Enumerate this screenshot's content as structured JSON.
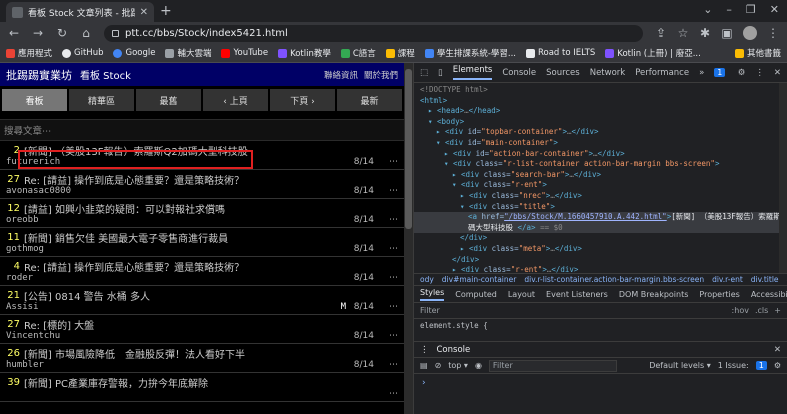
{
  "browser": {
    "tab_title": "看板 Stock 文章列表 - 批踢踢實業坊",
    "tab_close": "✕",
    "new_tab": "+",
    "url": "ptt.cc/bbs/Stock/index5421.html",
    "bookmarks": [
      {
        "label": "應用程式",
        "color": "#ea4335"
      },
      {
        "label": "GitHub",
        "color": "#e8eaed"
      },
      {
        "label": "Google",
        "color": "#4285f4"
      },
      {
        "label": "輔大雲端",
        "color": "#9aa0a6"
      },
      {
        "label": "YouTube",
        "color": "#ff0000"
      },
      {
        "label": "Kotlin教學",
        "color": "#7f52ff"
      },
      {
        "label": "C語言",
        "color": "#34a853"
      },
      {
        "label": "課程",
        "color": "#fbbc04"
      },
      {
        "label": "學生排課系統-學習...",
        "color": "#4285f4"
      },
      {
        "label": "Road to IELTS",
        "color": "#e8eaed"
      },
      {
        "label": "Kotlin (上冊) | 廢亞...",
        "color": "#7f52ff"
      }
    ],
    "bookmarks_other": "其他書籤"
  },
  "ptt": {
    "logo": "批踢踢實業坊",
    "board": "看板 Stock",
    "links": [
      "聯絡資訊",
      "關於我們"
    ],
    "actions": [
      "看板",
      "精華區",
      "最舊",
      "‹ 上頁",
      "下頁 ›",
      "最新"
    ],
    "search_placeholder": "搜尋文章⋯",
    "entries": [
      {
        "nrec": "2",
        "title": "[新聞] （美股13F報告）索羅斯Q2加碼大型科技股",
        "author": "futurerich",
        "mark": "",
        "date": "8/14"
      },
      {
        "nrec": "27",
        "title": "Re: [請益] 操作到底是心態重要？還是策略技術？",
        "author": "avonasac0800",
        "mark": "",
        "date": "8/14"
      },
      {
        "nrec": "12",
        "title": "[請益] 如興小韭菜的疑問：可以對報社求償嗎",
        "author": "oreobb",
        "mark": "",
        "date": "8/14"
      },
      {
        "nrec": "11",
        "title": "[新聞] 銷售欠佳 美國最大電子零售商進行裁員",
        "author": "gothmog",
        "mark": "",
        "date": "8/14"
      },
      {
        "nrec": "4",
        "title": "Re: [請益] 操作到底是心態重要？還是策略技術？",
        "author": "roder",
        "mark": "",
        "date": "8/14"
      },
      {
        "nrec": "21",
        "title": "[公告] 0814 警告 水桶 多人",
        "author": "Assisi",
        "mark": "M",
        "date": "8/14"
      },
      {
        "nrec": "27",
        "title": "Re: [標的] 大盤",
        "author": "Vincentchu",
        "mark": "",
        "date": "8/14"
      },
      {
        "nrec": "26",
        "title": "[新聞] 市場風險降低　金融股反彈！法人看好下半",
        "author": "humbler",
        "mark": "",
        "date": "8/14"
      },
      {
        "nrec": "39",
        "title": "[新聞] PC產業庫存警報，力拚今年底解除",
        "author": "",
        "mark": "",
        "date": ""
      }
    ],
    "more_glyph": "⋯"
  },
  "devtools": {
    "tabs": [
      "Elements",
      "Console",
      "Sources",
      "Network",
      "Performance",
      "»"
    ],
    "issues_badge": "1",
    "dom_lines": [
      {
        "indent": 0,
        "parts": [
          [
            "cmt",
            "<!DOCTYPE html>"
          ]
        ]
      },
      {
        "indent": 0,
        "parts": [
          [
            "tag",
            "<html>"
          ]
        ]
      },
      {
        "indent": 1,
        "parts": [
          [
            "tag",
            "▸ <head>"
          ],
          [
            "cmt",
            "…"
          ],
          [
            "tag",
            "</head>"
          ]
        ]
      },
      {
        "indent": 1,
        "parts": [
          [
            "tag",
            "▾ <body>"
          ]
        ]
      },
      {
        "indent": 2,
        "parts": [
          [
            "tag",
            "▸ <div "
          ],
          [
            "attr",
            "id="
          ],
          [
            "val",
            "\"topbar-container\""
          ],
          [
            "tag",
            ">"
          ],
          [
            "cmt",
            "…"
          ],
          [
            "tag",
            "</div>"
          ]
        ]
      },
      {
        "indent": 2,
        "parts": [
          [
            "tag",
            "▾ <div "
          ],
          [
            "attr",
            "id="
          ],
          [
            "val",
            "\"main-container\""
          ],
          [
            "tag",
            ">"
          ]
        ]
      },
      {
        "indent": 3,
        "parts": [
          [
            "tag",
            "▸ <div "
          ],
          [
            "attr",
            "id="
          ],
          [
            "val",
            "\"action-bar-container\""
          ],
          [
            "tag",
            ">"
          ],
          [
            "cmt",
            "…"
          ],
          [
            "tag",
            "</div>"
          ]
        ]
      },
      {
        "indent": 3,
        "parts": [
          [
            "tag",
            "▾ <div "
          ],
          [
            "attr",
            "class="
          ],
          [
            "val",
            "\"r-list-container action-bar-margin bbs-screen\""
          ],
          [
            "tag",
            ">"
          ]
        ]
      },
      {
        "indent": 4,
        "parts": [
          [
            "tag",
            "▸ <div "
          ],
          [
            "attr",
            "class="
          ],
          [
            "val",
            "\"search-bar\""
          ],
          [
            "tag",
            ">"
          ],
          [
            "cmt",
            "…"
          ],
          [
            "tag",
            "</div>"
          ]
        ]
      },
      {
        "indent": 4,
        "parts": [
          [
            "tag",
            "▾ <div "
          ],
          [
            "attr",
            "class="
          ],
          [
            "val",
            "\"r-ent\""
          ],
          [
            "tag",
            ">"
          ]
        ]
      },
      {
        "indent": 5,
        "parts": [
          [
            "tag",
            "▸ <div "
          ],
          [
            "attr",
            "class="
          ],
          [
            "val",
            "\"nrec\""
          ],
          [
            "tag",
            ">"
          ],
          [
            "cmt",
            "…"
          ],
          [
            "tag",
            "</div>"
          ]
        ]
      },
      {
        "indent": 5,
        "parts": [
          [
            "tag",
            "▾ <div "
          ],
          [
            "attr",
            "class="
          ],
          [
            "val",
            "\"title\""
          ],
          [
            "tag",
            ">"
          ]
        ]
      },
      {
        "indent": 6,
        "sel": true,
        "parts": [
          [
            "tag",
            "<a "
          ],
          [
            "attr",
            "href="
          ],
          [
            "link",
            "\"/bbs/Stock/M.1660457910.A.442.html\""
          ],
          [
            "tag",
            ">"
          ],
          [
            "txt",
            "[新聞] （美股13F報告）索羅斯Q2加"
          ]
        ]
      },
      {
        "indent": 6,
        "sel": true,
        "parts": [
          [
            "txt",
            "碼大型科技股 "
          ],
          [
            "tag",
            "</a>"
          ],
          [
            "cmt",
            " == $0"
          ]
        ]
      },
      {
        "indent": 5,
        "parts": [
          [
            "tag",
            "</div>"
          ]
        ]
      },
      {
        "indent": 5,
        "parts": [
          [
            "tag",
            "▸ <div "
          ],
          [
            "attr",
            "class="
          ],
          [
            "val",
            "\"meta\""
          ],
          [
            "tag",
            ">"
          ],
          [
            "cmt",
            "…"
          ],
          [
            "tag",
            "</div>"
          ]
        ]
      },
      {
        "indent": 4,
        "parts": [
          [
            "tag",
            "</div>"
          ]
        ]
      },
      {
        "indent": 4,
        "parts": [
          [
            "tag",
            "▸ <div "
          ],
          [
            "attr",
            "class="
          ],
          [
            "val",
            "\"r-ent\""
          ],
          [
            "tag",
            ">"
          ],
          [
            "cmt",
            "…"
          ],
          [
            "tag",
            "</div>"
          ]
        ]
      }
    ],
    "crumbs": [
      "ody",
      "div#main-container",
      "div.r-list-container.action-bar-margin.bbs-screen",
      "div.r-ent",
      "div.title",
      "a"
    ],
    "sub_tabs": [
      "Styles",
      "Computed",
      "Layout",
      "Event Listeners",
      "DOM Breakpoints",
      "Properties",
      "Accessibility"
    ],
    "filter_placeholder": "Filter",
    "filter_tools": [
      ":hov",
      ".cls",
      "+"
    ],
    "element_style": "element.style {",
    "console_title": "Console",
    "console_context": "top ▾",
    "console_filter": "Filter",
    "console_levels": "Default levels ▾",
    "console_issues": "1 Issue:",
    "console_issue_count": "1",
    "prompt": "›"
  },
  "colors": {
    "ptt_header": "#000066",
    "highlight": "#e02020",
    "nrec": "#ffff66"
  }
}
